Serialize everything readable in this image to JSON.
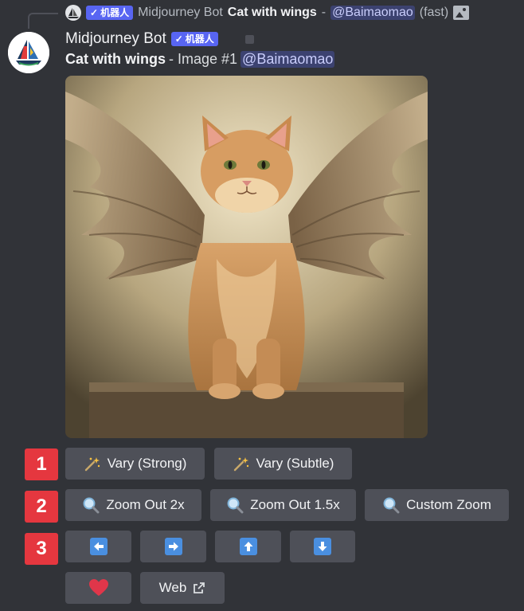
{
  "reply": {
    "bot_name": "Midjourney Bot",
    "badge": "机器人",
    "prompt": "Cat with wings",
    "separator": "-",
    "mention": "@Baimaomao",
    "mode": "(fast)"
  },
  "message": {
    "username": "Midjourney Bot",
    "badge": "机器人",
    "prompt": "Cat with wings",
    "suffix": "- Image #1",
    "mention": "@Baimaomao"
  },
  "row_markers": [
    "1",
    "2",
    "3"
  ],
  "buttons": {
    "vary_strong": "Vary (Strong)",
    "vary_subtle": "Vary (Subtle)",
    "zoom_out_2x": "Zoom Out 2x",
    "zoom_out_1_5x": "Zoom Out 1.5x",
    "custom_zoom": "Custom Zoom",
    "web": "Web"
  },
  "icons": {
    "vary": "magic-wand-icon",
    "zoom": "magnifier-icon",
    "pan": [
      "arrow-left-icon",
      "arrow-right-icon",
      "arrow-up-icon",
      "arrow-down-icon"
    ],
    "favorite": "heart-icon",
    "external": "external-link-icon"
  },
  "colors": {
    "background": "#313338",
    "button": "#4e5058",
    "marker": "#e5373f",
    "badge": "#5865f2",
    "arrow": "#4a8fe0",
    "heart": "#e0364a"
  }
}
